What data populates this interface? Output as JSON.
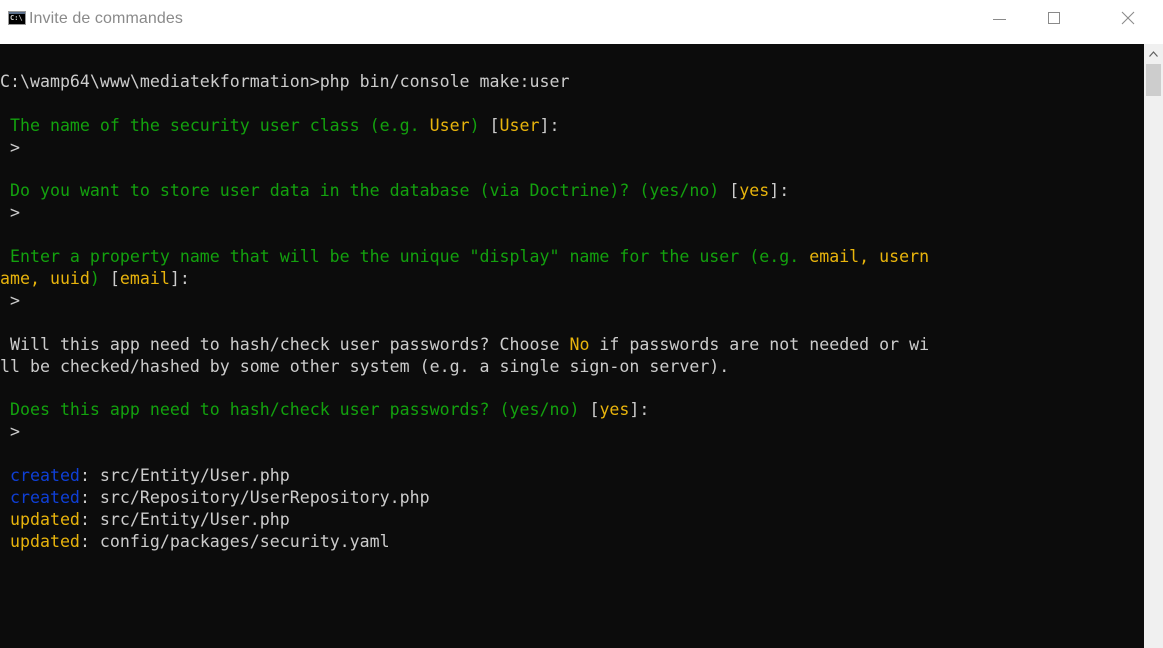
{
  "window": {
    "title": "Invite de commandes",
    "icon_text": "C:\\",
    "controls": {
      "minimize": "minimize-icon",
      "maximize": "maximize-icon",
      "close": "close-icon"
    }
  },
  "console": {
    "lines": [
      [
        {
          "t": "C:\\wamp64\\www\\mediatekformation>php bin/console make:user",
          "c": "w"
        }
      ],
      [],
      [
        {
          "t": " The name of the security user class (e.g. ",
          "c": "g"
        },
        {
          "t": "User",
          "c": "y"
        },
        {
          "t": ") ",
          "c": "g"
        },
        {
          "t": "[",
          "c": "w"
        },
        {
          "t": "User",
          "c": "y"
        },
        {
          "t": "]:",
          "c": "w"
        }
      ],
      [
        {
          "t": " >",
          "c": "w"
        }
      ],
      [],
      [
        {
          "t": " Do you want to store user data in the database (via Doctrine)? (yes/no) ",
          "c": "g"
        },
        {
          "t": "[",
          "c": "w"
        },
        {
          "t": "yes",
          "c": "y"
        },
        {
          "t": "]:",
          "c": "w"
        }
      ],
      [
        {
          "t": " >",
          "c": "w"
        }
      ],
      [],
      [
        {
          "t": " Enter a property name that will be the unique \"display\" name for the user (e.g. ",
          "c": "g"
        },
        {
          "t": "email, usern",
          "c": "y"
        }
      ],
      [
        {
          "t": "ame, uuid",
          "c": "y"
        },
        {
          "t": ") ",
          "c": "g"
        },
        {
          "t": "[",
          "c": "w"
        },
        {
          "t": "email",
          "c": "y"
        },
        {
          "t": "]:",
          "c": "w"
        }
      ],
      [
        {
          "t": " >",
          "c": "w"
        }
      ],
      [],
      [
        {
          "t": " Will this app need to hash/check user passwords? Choose ",
          "c": "w"
        },
        {
          "t": "No",
          "c": "y"
        },
        {
          "t": " if passwords are not needed or wi",
          "c": "w"
        }
      ],
      [
        {
          "t": "ll be checked/hashed by some other system (e.g. a single sign-on server).",
          "c": "w"
        }
      ],
      [],
      [
        {
          "t": " Does this app need to hash/check user passwords? (yes/no) ",
          "c": "g"
        },
        {
          "t": "[",
          "c": "w"
        },
        {
          "t": "yes",
          "c": "y"
        },
        {
          "t": "]:",
          "c": "w"
        }
      ],
      [
        {
          "t": " >",
          "c": "w"
        }
      ],
      [],
      [
        {
          "t": " created",
          "c": "b"
        },
        {
          "t": ": src/Entity/User.php",
          "c": "w"
        }
      ],
      [
        {
          "t": " created",
          "c": "b"
        },
        {
          "t": ": src/Repository/UserRepository.php",
          "c": "w"
        }
      ],
      [
        {
          "t": " updated",
          "c": "y"
        },
        {
          "t": ": src/Entity/User.php",
          "c": "w"
        }
      ],
      [
        {
          "t": " updated",
          "c": "y"
        },
        {
          "t": ": config/packages/security.yaml",
          "c": "w"
        }
      ]
    ]
  },
  "colors": {
    "background": "#0c0c0c",
    "text": "#cccccc",
    "green": "#13a10e",
    "yellow": "#e8b40c",
    "blue": "#0f3fd6"
  },
  "scrollbar": {
    "up_icon": "chevron-up-icon"
  }
}
